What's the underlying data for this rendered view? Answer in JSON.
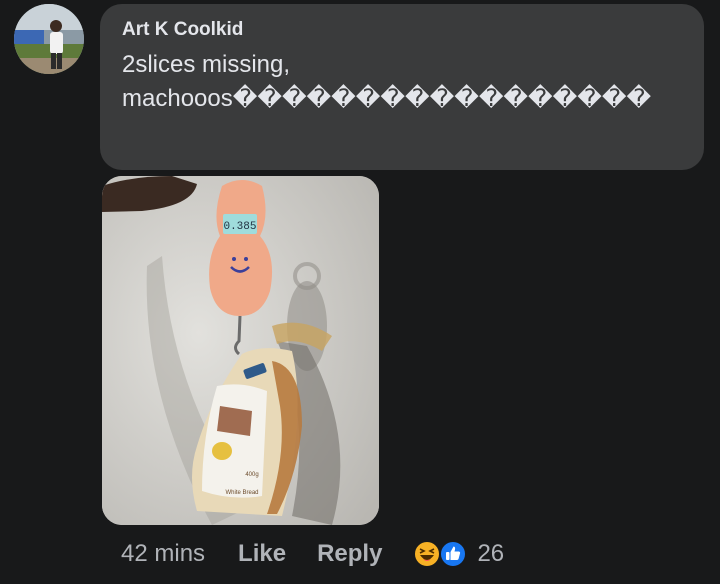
{
  "comment": {
    "author": "Art K Coolkid",
    "text": "2slices missing, machooos�����������������",
    "scale_display": "0.385",
    "bread_label": "White Bread",
    "bread_weight": "400g"
  },
  "actions": {
    "timestamp": "42 mins",
    "like_label": "Like",
    "reply_label": "Reply",
    "reaction_count": "26",
    "reaction_icons": [
      "haha-icon",
      "like-icon"
    ]
  },
  "colors": {
    "background": "#18191a",
    "bubble": "#3a3b3c",
    "text_primary": "#e4e6eb",
    "text_secondary": "#b0b3b8",
    "like_blue": "#1877f2",
    "haha_yellow": "#f7b125"
  }
}
